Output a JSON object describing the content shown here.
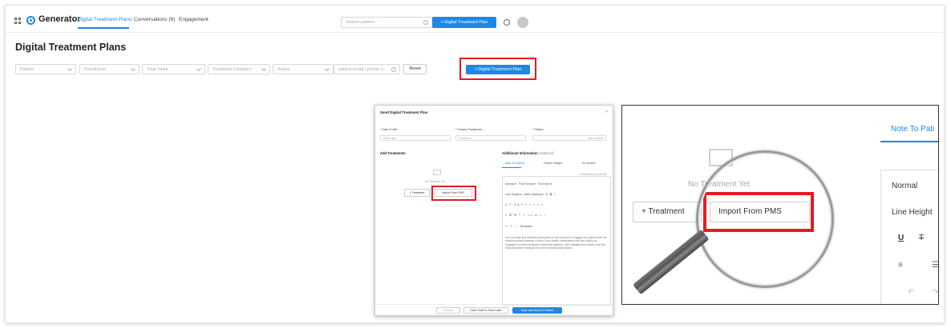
{
  "nav": {
    "brand": "Generator",
    "tabs": [
      {
        "label": "Digital Treatment Plans",
        "active": true
      },
      {
        "label": "Conversations (6)",
        "active": false
      },
      {
        "label": "Engagement",
        "active": false
      }
    ],
    "search_placeholder": "Search patient...",
    "new_plan_label": "+ Digital Treatment Plan"
  },
  "page": {
    "title": "Digital Treatment Plans"
  },
  "filters": {
    "patient": "Patient",
    "practitioner": "Practitioner",
    "total_value": "Total Value",
    "treatment_category": "Treatment Category",
    "status": "Status",
    "email_placeholder": "patient email / phone n...",
    "reset_label": "Reset",
    "new_plan_label": "+ Digital Treatment Plan"
  },
  "modal": {
    "title": "Send Digital Treatment Plan",
    "close": "×",
    "date_label": "* Date of Visit:",
    "date_placeholder": "Select date",
    "practitioner_label": "* Primary Practitioner:",
    "practitioner_placeholder": "Practitioner",
    "patient_label": "* Patient:",
    "patient_placeholder": "select patient",
    "add_treatments": "Add Treatments",
    "additional_info": "Additional Information",
    "optional": "(Optional)",
    "tabs": [
      "Note To Patient",
      "Patient Images",
      "3D Models"
    ],
    "char_counter": "0 characters (max 5000)",
    "empty_text": "No Treatment Yet",
    "treatment_btn": "+ Treatment",
    "import_btn": "Import From PMS",
    "toolbar": {
      "normal": "Normal",
      "font_family": "Font Family",
      "font_size": "Font Size",
      "line_height": "Line Height",
      "letter_spacing": "Letter Spacing",
      "templates": "Templates"
    },
    "body_text": "You can add any relevant information in this section to engage the patient with the most important aspects of their Oral Health. Information that can highly be engaged includes treatment recommendations, self-management advice and the most important findings from their clinical examination.",
    "footer": {
      "preview": "Preview",
      "save_draft": "Save Draft To Send Later",
      "save_send": "Save and Send To Patient"
    }
  },
  "zoom": {
    "tab_label": "Note To Pati",
    "empty_text": "No Treatment Yet",
    "treatment_btn": "+ Treatment",
    "import_btn": "Import From PMS",
    "normal": "Normal",
    "line_height": "Line Height"
  }
}
